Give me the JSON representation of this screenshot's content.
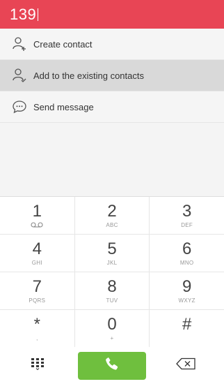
{
  "dial": {
    "number": "139"
  },
  "options": [
    {
      "label": "Create contact",
      "icon": "person-add-icon"
    },
    {
      "label": "Add to the existing contacts",
      "icon": "person-check-icon",
      "selected": true
    },
    {
      "label": "Send message",
      "icon": "message-bubble-icon"
    }
  ],
  "keypad": {
    "keys": [
      {
        "digit": "1",
        "sub": ""
      },
      {
        "digit": "2",
        "sub": "ABC"
      },
      {
        "digit": "3",
        "sub": "DEF"
      },
      {
        "digit": "4",
        "sub": "GHI"
      },
      {
        "digit": "5",
        "sub": "JKL"
      },
      {
        "digit": "6",
        "sub": "MNO"
      },
      {
        "digit": "7",
        "sub": "PQRS"
      },
      {
        "digit": "8",
        "sub": "TUV"
      },
      {
        "digit": "9",
        "sub": "WXYZ"
      },
      {
        "digit": "*",
        "sub": ","
      },
      {
        "digit": "0",
        "sub": "+"
      },
      {
        "digit": "#",
        "sub": ""
      }
    ],
    "voicemail_icon": "voicemail-icon"
  },
  "bottom": {
    "left_icon": "dialpad-toggle-icon",
    "call_icon": "phone-call-icon",
    "right_icon": "backspace-icon",
    "call_color": "#6fbf3e"
  },
  "colors": {
    "accent": "#e84555"
  }
}
